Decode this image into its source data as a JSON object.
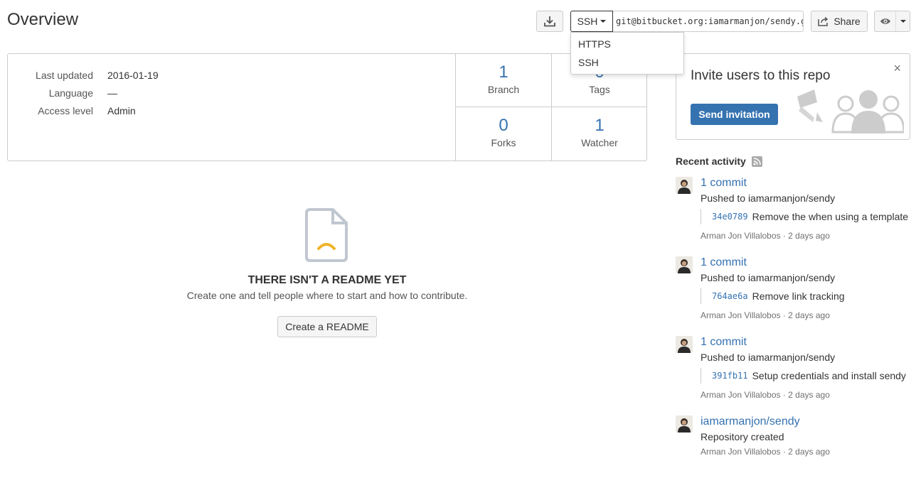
{
  "header": {
    "title": "Overview"
  },
  "toolbar": {
    "download_icon": "download-icon",
    "clone_protocol": "SSH",
    "clone_url": "git@bitbucket.org:iamarmanjon/sendy.git",
    "share_label": "Share",
    "watch_icon": "eye-icon"
  },
  "protocol_menu": {
    "items": [
      "HTTPS",
      "SSH"
    ]
  },
  "repo_info": {
    "meta": [
      {
        "key": "Last updated",
        "value": "2016-01-19"
      },
      {
        "key": "Language",
        "value": "—"
      },
      {
        "key": "Access level",
        "value": "Admin"
      }
    ],
    "stats": [
      {
        "value": "1",
        "label": "Branch"
      },
      {
        "value": "0",
        "label": "Tags"
      },
      {
        "value": "0",
        "label": "Forks"
      },
      {
        "value": "1",
        "label": "Watcher"
      }
    ]
  },
  "readme": {
    "title": "THERE ISN'T A README YET",
    "description": "Create one and tell people where to start and how to contribute.",
    "button": "Create a README"
  },
  "invite": {
    "title": "Invite users to this repo",
    "button": "Send invitation",
    "close": "×"
  },
  "activity": {
    "heading": "Recent activity",
    "items": [
      {
        "title": "1 commit",
        "subtitle": "Pushed to iamarmanjon/sendy",
        "hash": "34e0789",
        "message": "Remove the when using a template",
        "meta": "Arman Jon Villalobos · 2 days ago"
      },
      {
        "title": "1 commit",
        "subtitle": "Pushed to iamarmanjon/sendy",
        "hash": "764ae6a",
        "message": "Remove link tracking",
        "meta": "Arman Jon Villalobos · 2 days ago"
      },
      {
        "title": "1 commit",
        "subtitle": "Pushed to iamarmanjon/sendy",
        "hash": "391fb11",
        "message": "Setup credentials and install sendy",
        "meta": "Arman Jon Villalobos · 2 days ago"
      },
      {
        "title": "iamarmanjon/sendy",
        "subtitle": "Repository created",
        "meta": "Arman Jon Villalobos · 2 days ago"
      }
    ]
  },
  "colors": {
    "link": "#3572b0",
    "primary_button": "#3572b0",
    "readme_icon_accent": "#f0b429"
  }
}
